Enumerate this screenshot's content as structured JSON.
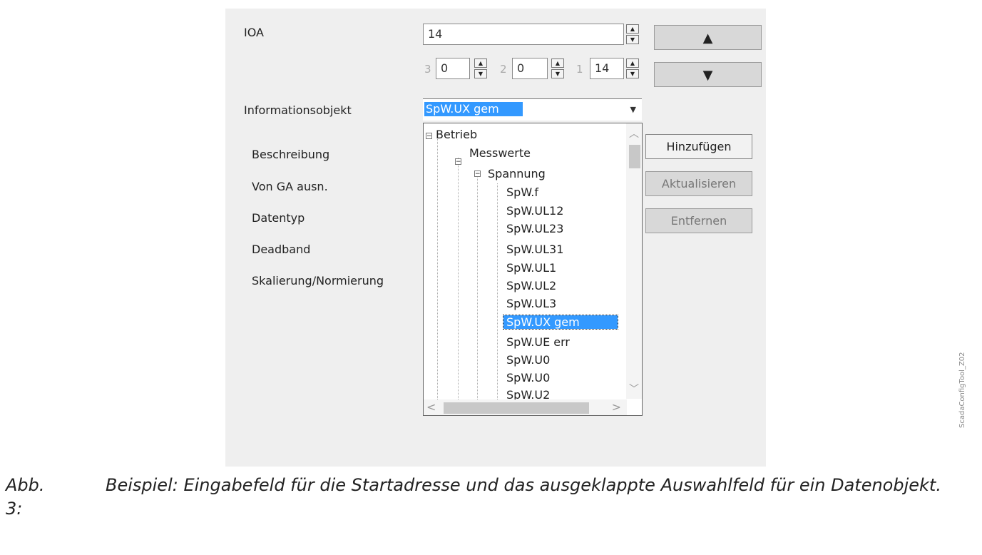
{
  "form": {
    "ioa_label": "IOA",
    "ioa_value": "14",
    "octets": [
      {
        "index": "3",
        "value": "0"
      },
      {
        "index": "2",
        "value": "0"
      },
      {
        "index": "1",
        "value": "14"
      }
    ],
    "info_object_label": "Informationsobjekt",
    "info_object_selected": "SpW.UX gem",
    "labels": [
      "Beschreibung",
      "Von GA ausn.",
      "Datentyp",
      "Deadband",
      "Skalierung/Normierung"
    ]
  },
  "buttons": {
    "up": "▲",
    "down": "▼",
    "add": "Hinzufügen",
    "update": "Aktualisieren",
    "remove": "Entfernen"
  },
  "tree": {
    "root": "Betrieb",
    "level1": "Messwerte",
    "level2": "Spannung",
    "items": [
      "SpW.f",
      "SpW.UL12",
      "SpW.UL23",
      "SpW.UL31",
      "SpW.UL1",
      "SpW.UL2",
      "SpW.UL3",
      "SpW.UX gem",
      "SpW.UE err",
      "SpW.U0",
      "SpW.U0",
      "SpW.U2"
    ],
    "selected_index": 7
  },
  "caption": {
    "number": "Abb. 3:",
    "text": "Beispiel: Eingabefeld für die Startadresse und das ausgeklappte Auswahlfeld für ein Datenobjekt."
  },
  "side_caption": "ScadaConfigTool_Z02",
  "colors": {
    "selection": "#3399ff",
    "panel": "#efefef"
  }
}
